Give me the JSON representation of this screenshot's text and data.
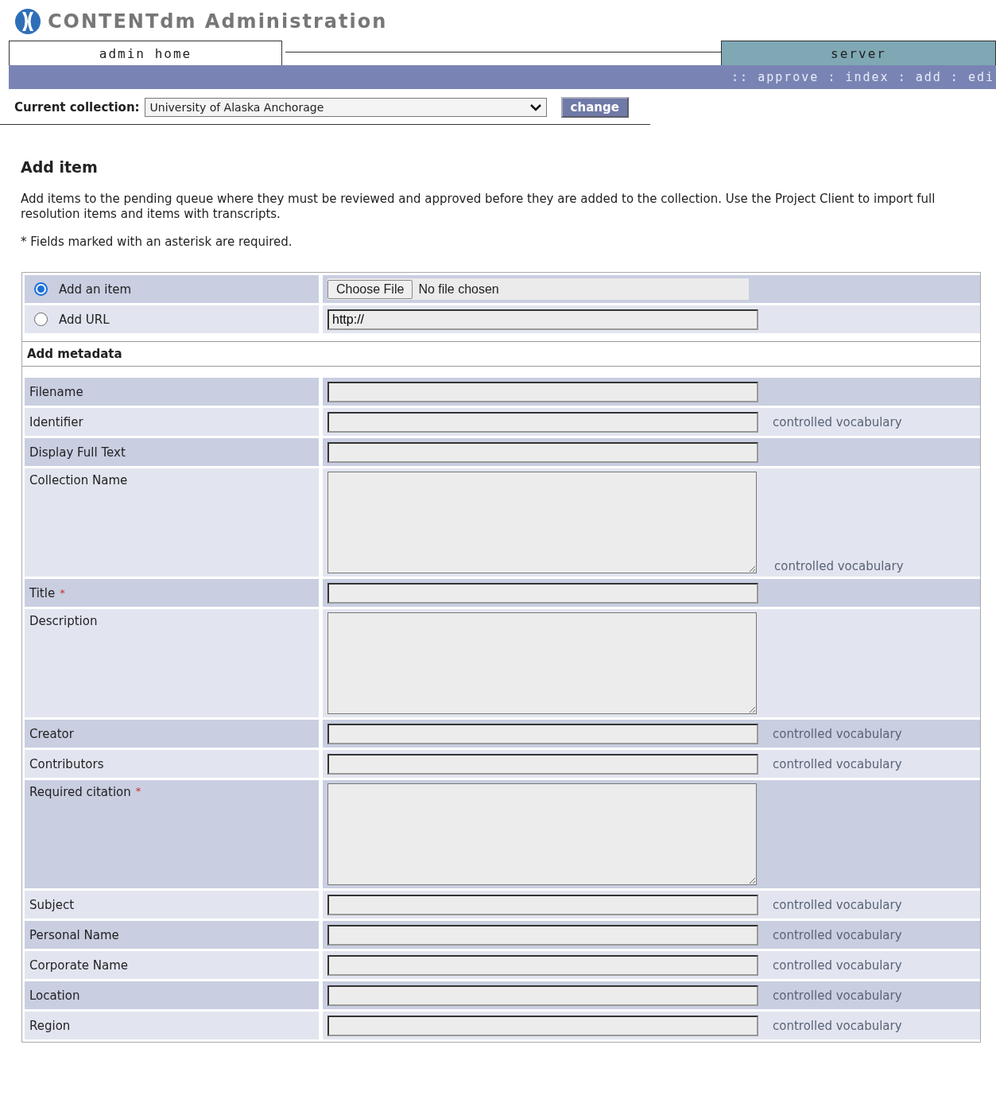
{
  "header": {
    "title": "CONTENTdm Administration"
  },
  "tabs": [
    {
      "label": "admin home",
      "selected": true
    },
    {
      "label": "server",
      "selected": false
    }
  ],
  "subnav": ":: approve : index : add : edi",
  "collection": {
    "label": "Current collection:",
    "value": "University of Alaska Anchorage",
    "button": "change"
  },
  "page": {
    "heading": "Add item",
    "intro": "Add items to the pending queue where they must be reviewed and approved before they are added to the collection. Use the Project Client to import full resolution items and items with transcripts.",
    "note": "* Fields marked with an asterisk are required."
  },
  "source": [
    {
      "label": "Add an item",
      "selected": true,
      "kind": "file",
      "button": "Choose File",
      "status": "No file chosen"
    },
    {
      "label": "Add URL",
      "selected": false,
      "kind": "url",
      "value": "http://"
    }
  ],
  "metadata_heading": "Add metadata",
  "fields": [
    {
      "label": "Filename",
      "kind": "text"
    },
    {
      "label": "Identifier",
      "kind": "text",
      "hint": "controlled vocabulary"
    },
    {
      "label": "Display Full Text",
      "kind": "text"
    },
    {
      "label": "Collection Name",
      "kind": "textarea",
      "hint": "controlled vocabulary"
    },
    {
      "label": "Title",
      "kind": "text",
      "required_mark": "*"
    },
    {
      "label": "Description",
      "kind": "textarea"
    },
    {
      "label": "Creator",
      "kind": "text",
      "hint": "controlled vocabulary"
    },
    {
      "label": "Contributors",
      "kind": "text",
      "hint": "controlled vocabulary"
    },
    {
      "label": "Required citation",
      "kind": "textarea",
      "required_mark": "*"
    },
    {
      "label": "Subject",
      "kind": "text",
      "hint": "controlled vocabulary"
    },
    {
      "label": "Personal Name",
      "kind": "text",
      "hint": "controlled vocabulary"
    },
    {
      "label": "Corporate Name",
      "kind": "text",
      "hint": "controlled vocabulary"
    },
    {
      "label": "Location",
      "kind": "text",
      "hint": "controlled vocabulary"
    },
    {
      "label": "Region",
      "kind": "text",
      "hint": "controlled vocabulary"
    }
  ]
}
